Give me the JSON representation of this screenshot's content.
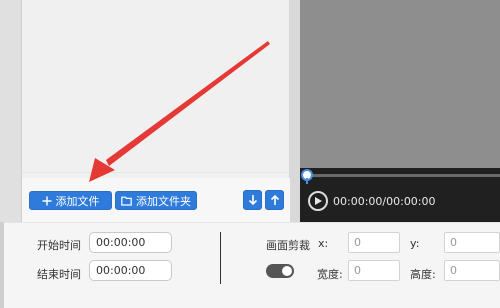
{
  "file_list": {
    "add_file_label": "添加文件",
    "add_folder_label": "添加文件夹"
  },
  "player": {
    "time_readout": "00:00:00/00:00:00"
  },
  "trim": {
    "start_label": "开始时间",
    "start_value": "00:00:00",
    "end_label": "结束时间",
    "end_value": "00:00:00"
  },
  "crop": {
    "title": "画面剪裁",
    "x_label": "x:",
    "x_value": "0",
    "y_label": "y:",
    "y_value": "0",
    "width_label": "宽度:",
    "width_value": "0",
    "height_label": "高度:",
    "height_value": "0",
    "enabled": false
  },
  "colors": {
    "accent": "#2f7bdc",
    "annotation": "#e53935",
    "player_bg": "#202020",
    "preview_bg": "#8e8e8e"
  }
}
